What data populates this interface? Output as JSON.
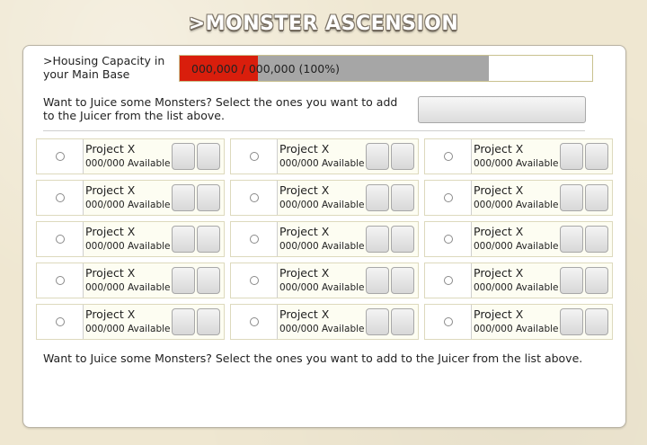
{
  "app": {
    "title": ">MONSTER ASCENSION"
  },
  "housing": {
    "label": ">Housing Capacity in your Main Base",
    "progress_text": "000,000 / 000,000 (100%)",
    "used_fraction": 0.19,
    "allocated_fraction": 0.75,
    "used_color": "#d91e0c",
    "allocated_color": "#a6a6a6"
  },
  "juicer": {
    "prompt": "Want to Juice some Monsters? Select the ones you want to add to the Juicer from the list above.",
    "button_label": ""
  },
  "monsters": [
    {
      "name": "Project X",
      "available": "000/000 Available"
    },
    {
      "name": "Project X",
      "available": "000/000 Available"
    },
    {
      "name": "Project X",
      "available": "000/000 Available"
    },
    {
      "name": "Project X",
      "available": "000/000 Available"
    },
    {
      "name": "Project X",
      "available": "000/000 Available"
    },
    {
      "name": "Project X",
      "available": "000/000 Available"
    },
    {
      "name": "Project X",
      "available": "000/000 Available"
    },
    {
      "name": "Project X",
      "available": "000/000 Available"
    },
    {
      "name": "Project X",
      "available": "000/000 Available"
    },
    {
      "name": "Project X",
      "available": "000/000 Available"
    },
    {
      "name": "Project X",
      "available": "000/000 Available"
    },
    {
      "name": "Project X",
      "available": "000/000 Available"
    },
    {
      "name": "Project X",
      "available": "000/000 Available"
    },
    {
      "name": "Project X",
      "available": "000/000 Available"
    },
    {
      "name": "Project X",
      "available": "000/000 Available"
    }
  ],
  "footer": {
    "text": "Want to Juice some Monsters? Select the ones you want to add to the Juicer from the list above."
  }
}
